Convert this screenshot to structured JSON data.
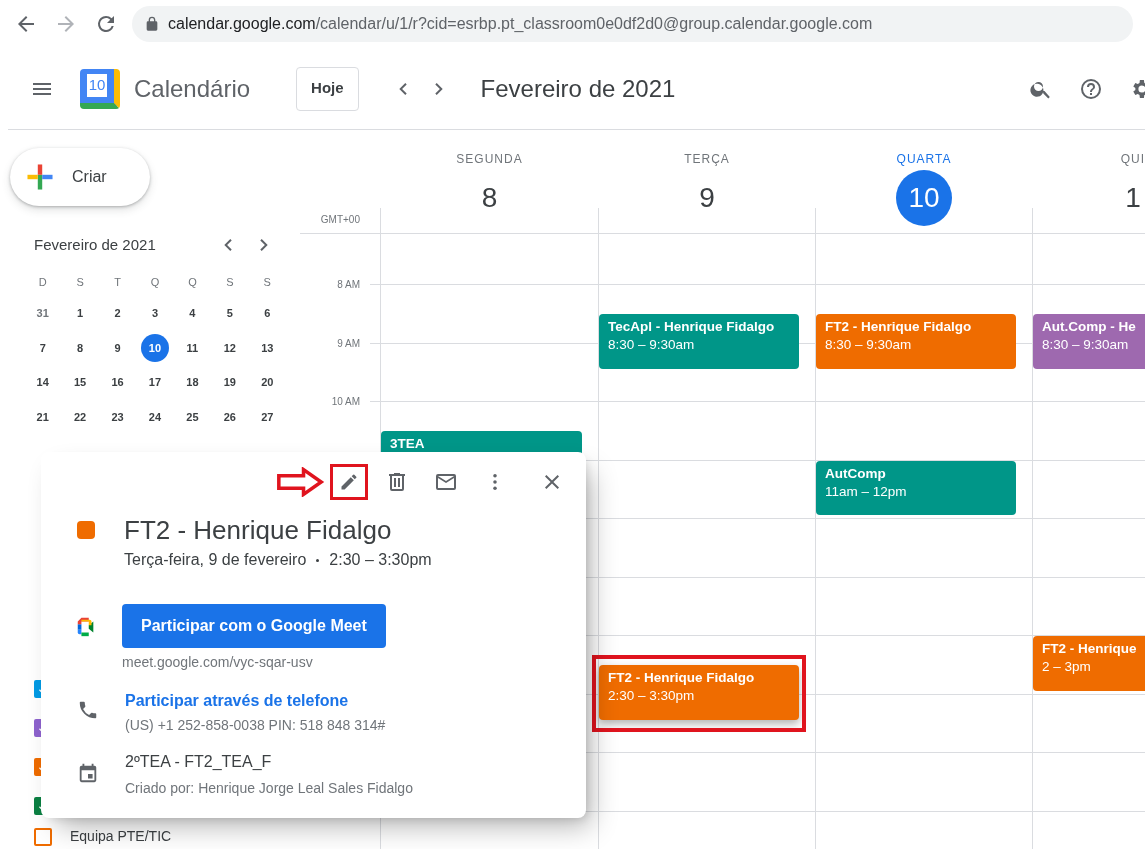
{
  "browser": {
    "url_host": "calendar.google.com",
    "url_path": "/calendar/u/1/r?cid=esrbp.pt_classroom0e0df2d0@group.calendar.google.com"
  },
  "header": {
    "app_name": "Calendário",
    "logo_day": "10",
    "today_button": "Hoje",
    "period": "Fevereiro de 2021"
  },
  "sidebar": {
    "create_button": "Criar",
    "mini_calendar": {
      "title": "Fevereiro de 2021",
      "weekdays": [
        "D",
        "S",
        "T",
        "Q",
        "Q",
        "S",
        "S"
      ],
      "weeks": [
        [
          {
            "day": "31",
            "other_month": true,
            "selected": false
          },
          {
            "day": "1",
            "other_month": false,
            "selected": false
          },
          {
            "day": "2",
            "other_month": false,
            "selected": false
          },
          {
            "day": "3",
            "other_month": false,
            "selected": false
          },
          {
            "day": "4",
            "other_month": false,
            "selected": false
          },
          {
            "day": "5",
            "other_month": false,
            "selected": false
          },
          {
            "day": "6",
            "other_month": false,
            "selected": false
          }
        ],
        [
          {
            "day": "7",
            "other_month": false,
            "selected": false
          },
          {
            "day": "8",
            "other_month": false,
            "selected": false
          },
          {
            "day": "9",
            "other_month": false,
            "selected": false
          },
          {
            "day": "10",
            "other_month": false,
            "selected": true
          },
          {
            "day": "11",
            "other_month": false,
            "selected": false
          },
          {
            "day": "12",
            "other_month": false,
            "selected": false
          },
          {
            "day": "13",
            "other_month": false,
            "selected": false
          }
        ],
        [
          {
            "day": "14",
            "other_month": false,
            "selected": false
          },
          {
            "day": "15",
            "other_month": false,
            "selected": false
          },
          {
            "day": "16",
            "other_month": false,
            "selected": false
          },
          {
            "day": "17",
            "other_month": false,
            "selected": false
          },
          {
            "day": "18",
            "other_month": false,
            "selected": false
          },
          {
            "day": "19",
            "other_month": false,
            "selected": false
          },
          {
            "day": "20",
            "other_month": false,
            "selected": false
          }
        ],
        [
          {
            "day": "21",
            "other_month": false,
            "selected": false
          },
          {
            "day": "22",
            "other_month": false,
            "selected": false
          },
          {
            "day": "23",
            "other_month": false,
            "selected": false
          },
          {
            "day": "24",
            "other_month": false,
            "selected": false
          },
          {
            "day": "25",
            "other_month": false,
            "selected": false
          },
          {
            "day": "26",
            "other_month": false,
            "selected": false
          },
          {
            "day": "27",
            "other_month": false,
            "selected": false
          }
        ]
      ]
    },
    "calendars": [
      {
        "color": "#039be5",
        "checked": true
      },
      {
        "color": "#8e63ce",
        "checked": true
      },
      {
        "color": "#ef6c00",
        "checked": true
      },
      {
        "color": "#0b8043",
        "checked": true
      },
      {
        "label": "Equipa PTE/TIC",
        "color": "#ef6c00",
        "checked": false
      }
    ]
  },
  "timezone": "GMT+00",
  "hours": [
    "8 AM",
    "9 AM",
    "10 AM"
  ],
  "days": [
    {
      "weekday": "SEGUNDA",
      "date": "8",
      "selected": false,
      "events": [
        {
          "title": "3TEA",
          "color": "#009688"
        }
      ]
    },
    {
      "weekday": "TERÇA",
      "date": "9",
      "selected": false,
      "events": [
        {
          "title": "TecApl - Henrique Fidalgo",
          "time": "8:30 – 9:30am",
          "color": "#009688"
        },
        {
          "title": "FT2 - Henrique Fidalgo",
          "time": "2:30 – 3:30pm",
          "color": "#ef6c00"
        }
      ]
    },
    {
      "weekday": "QUARTA",
      "date": "10",
      "selected": true,
      "events": [
        {
          "title": "FT2 - Henrique Fidalgo",
          "time": "8:30 – 9:30am",
          "color": "#ef6c00"
        },
        {
          "title": "AutComp",
          "time": "11am – 12pm",
          "color": "#009688"
        }
      ]
    },
    {
      "weekday": "QUI",
      "date": "1",
      "selected": false,
      "events": [
        {
          "title": "Aut.Comp - He",
          "time": "8:30 – 9:30am",
          "color": "#9e69af"
        },
        {
          "title": "FT2 - Henrique",
          "time": "2 – 3pm",
          "color": "#ef6c00"
        }
      ]
    }
  ],
  "event_popup": {
    "title": "FT2 - Henrique Fidalgo",
    "color": "#ef6c00",
    "date": "Terça-feira, 9 de fevereiro",
    "time": "2:30 – 3:30pm",
    "meet_button": "Participar com o Google Meet",
    "meet_link": "meet.google.com/vyc-sqar-usv",
    "phone_link": "Participar através de telefone",
    "phone_details": "(US) +1 252-858-0038 PIN: 518 848 314#",
    "calendar_name": "2ºTEA - FT2_TEA_F",
    "creator": "Criado por: Henrique Jorge Leal Sales Fidalgo"
  }
}
